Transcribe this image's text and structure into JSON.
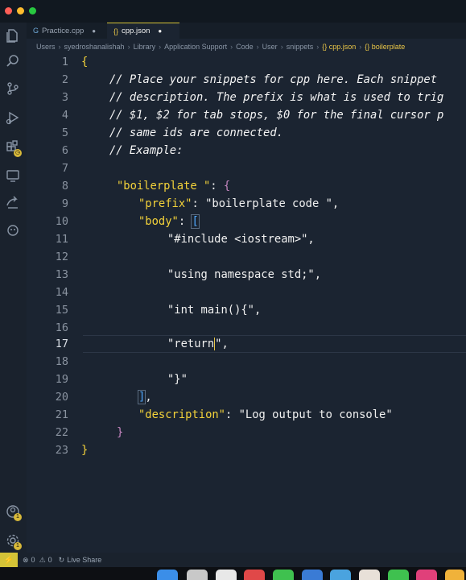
{
  "tabs": [
    {
      "label": "Practice.cpp",
      "icon": "G",
      "active": false,
      "modified": true
    },
    {
      "label": "cpp.json",
      "icon": "{}",
      "active": true,
      "modified": true
    }
  ],
  "breadcrumb": [
    "Users",
    "syedroshanalishah",
    "Library",
    "Application Support",
    "Code",
    "User",
    "snippets",
    "{} cpp.json",
    "{} boilerplate"
  ],
  "editor": {
    "line_numbers": [
      "1",
      "2",
      "3",
      "4",
      "5",
      "6",
      "7",
      "8",
      "9",
      "10",
      "11",
      "12",
      "13",
      "14",
      "15",
      "16",
      "17",
      "18",
      "19",
      "20",
      "21",
      "22",
      "23"
    ],
    "current_line": "17",
    "lines": {
      "l1": "{",
      "l2": "// Place your snippets for cpp here. Each snippet",
      "l3": "// description. The prefix is what is used to trig",
      "l4": "// $1, $2 for tab stops, $0 for the final cursor p",
      "l5": "// same ids are connected.",
      "l6": "// Example:",
      "l8_key": "\"boilerplate \"",
      "l8_rest": ": ",
      "l8_brace": "{",
      "l9_key": "\"prefix\"",
      "l9_colon": ": ",
      "l9_val": "\"boilerplate code \",",
      "l10_key": "\"body\"",
      "l10_colon": ": ",
      "l10_brack": "[",
      "l11": "\"#include <iostream>\",",
      "l13": "\"using namespace std;\",",
      "l15": "\"int main(){\",",
      "l17_a": "\"return",
      "l17_b": "\",",
      "l19": "\"}\"",
      "l20_brack": "]",
      "l20_comma": ",",
      "l21_key": "\"description\"",
      "l21_colon": ": ",
      "l21_val": "\"Log output to console\"",
      "l22": "}",
      "l23": "}"
    }
  },
  "status": {
    "remote_icon": "remote-icon",
    "problems": "0",
    "warnings": "0",
    "live_share": "Live Share"
  },
  "activity_badges": {
    "extensions": "",
    "accounts": "1",
    "settings": "1"
  },
  "colors": {
    "accent": "#d4c337",
    "background": "#1b2431",
    "json_key": "#f3d23a",
    "bracket": "#4fa8ff",
    "brace": "#c586c0"
  }
}
